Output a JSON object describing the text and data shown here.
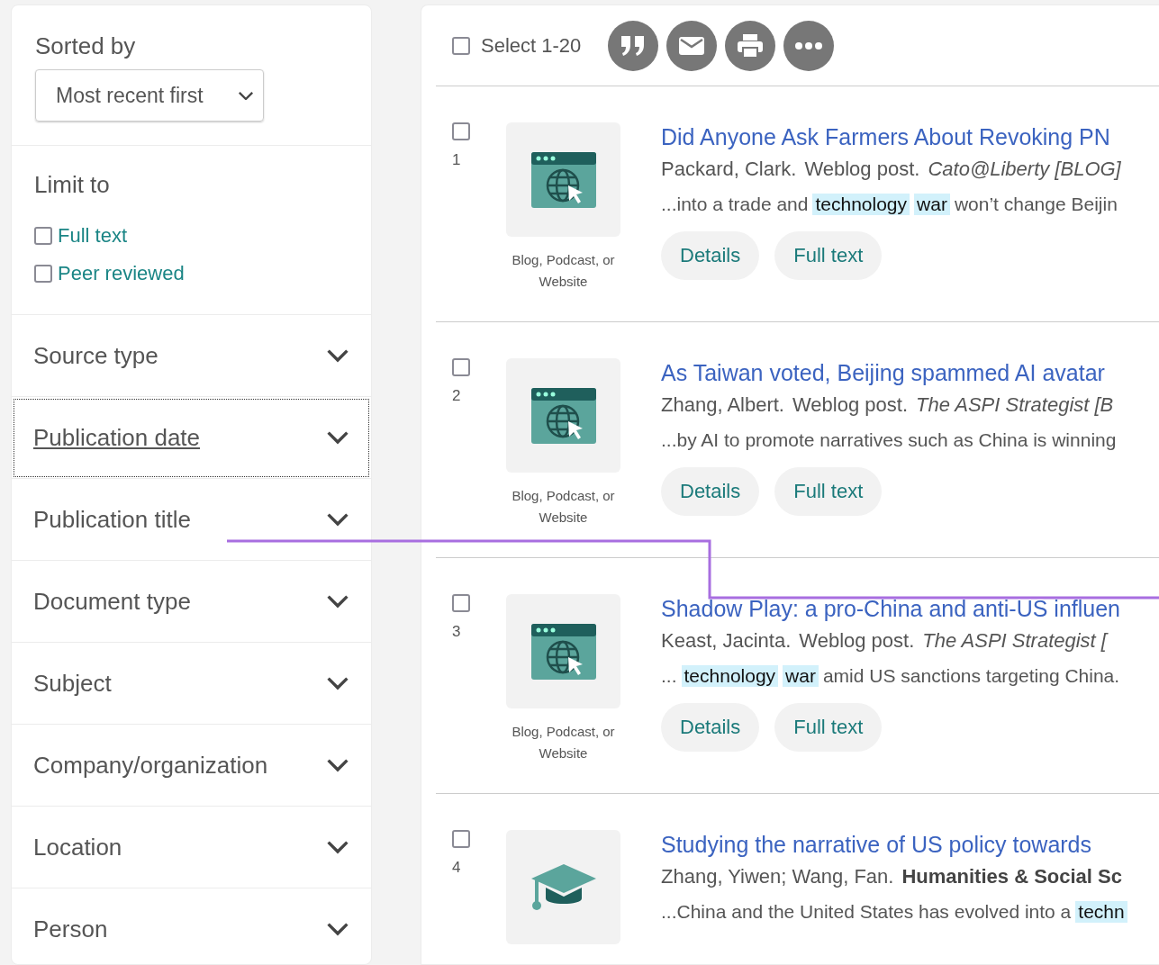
{
  "sort": {
    "label": "Sorted by",
    "value": "Most recent first"
  },
  "limit": {
    "title": "Limit to",
    "options": [
      {
        "label": "Full text",
        "checked": false
      },
      {
        "label": "Peer reviewed",
        "checked": false
      }
    ]
  },
  "facets": [
    {
      "label": "Source type",
      "focused": false
    },
    {
      "label": "Publication date",
      "focused": true
    },
    {
      "label": "Publication title",
      "focused": false
    },
    {
      "label": "Document type",
      "focused": false
    },
    {
      "label": "Subject",
      "focused": false
    },
    {
      "label": "Company/organization",
      "focused": false
    },
    {
      "label": "Location",
      "focused": false
    },
    {
      "label": "Person",
      "focused": false
    }
  ],
  "toolbar": {
    "select_label": "Select 1-20",
    "select_checked": false,
    "actions": [
      {
        "kind": "quote"
      },
      {
        "kind": "mail"
      },
      {
        "kind": "print"
      },
      {
        "kind": "more"
      }
    ]
  },
  "results": [
    {
      "number": "1",
      "checked": false,
      "kind": "web",
      "type_label": "Blog, Podcast, or Website",
      "title": "Did Anyone Ask Farmers About Revoking PN",
      "authors": "Packard, Clark.",
      "doc_type": "Weblog post.",
      "source": {
        "text": "Cato@Liberty [BLOG]",
        "kind": "italic"
      },
      "snippet": [
        {
          "text": "...into a trade and",
          "highlight": false
        },
        {
          "text": "technology",
          "highlight": true
        },
        {
          "text": "war",
          "highlight": true
        },
        {
          "text": "won’t change Beijin",
          "highlight": false
        }
      ],
      "buttons": [
        "Details",
        "Full text"
      ]
    },
    {
      "number": "2",
      "checked": false,
      "kind": "web",
      "type_label": "Blog, Podcast, or Website",
      "title": "As Taiwan voted, Beijing spammed AI avatar",
      "authors": "Zhang, Albert.",
      "doc_type": "Weblog post.",
      "source": {
        "text": "The ASPI Strategist [B",
        "kind": "italic"
      },
      "snippet": [
        {
          "text": "...by AI to promote narratives such as China is winning",
          "highlight": false
        }
      ],
      "buttons": [
        "Details",
        "Full text"
      ]
    },
    {
      "number": "3",
      "checked": false,
      "kind": "web",
      "type_label": "Blog, Podcast, or Website",
      "title": "Shadow Play: a pro-China and anti-US influen",
      "authors": "Keast, Jacinta.",
      "doc_type": "Weblog post.",
      "source": {
        "text": "The ASPI Strategist [",
        "kind": "italic"
      },
      "snippet": [
        {
          "text": "...",
          "highlight": false
        },
        {
          "text": "technology",
          "highlight": true
        },
        {
          "text": "war",
          "highlight": true
        },
        {
          "text": "amid US sanctions targeting China.",
          "highlight": false
        }
      ],
      "buttons": [
        "Details",
        "Full text"
      ]
    },
    {
      "number": "4",
      "checked": false,
      "kind": "scholarly",
      "title": "Studying the narrative of US policy towards",
      "authors": "Zhang, Yiwen; Wang, Fan.",
      "source": {
        "text": "Humanities & Social Sc",
        "kind": "bold"
      },
      "snippet": [
        {
          "text": "...China and the United States has evolved into a",
          "highlight": false
        },
        {
          "text": "techn",
          "highlight": true
        }
      ]
    }
  ]
}
